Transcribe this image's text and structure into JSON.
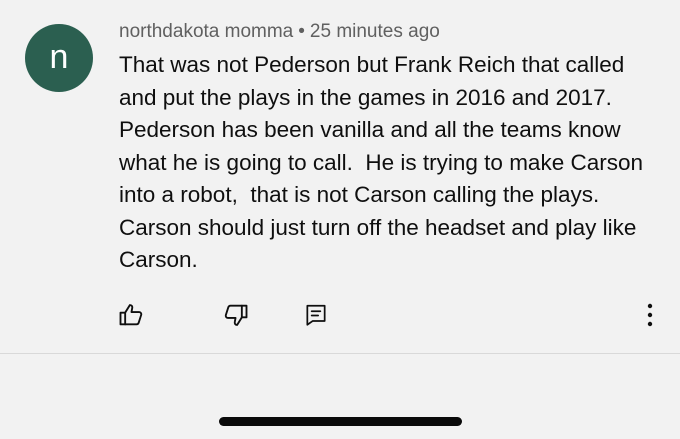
{
  "comment": {
    "avatar_letter": "n",
    "avatar_color": "#2b5f50",
    "author": "northdakota momma",
    "separator": "•",
    "timestamp": "25 minutes ago",
    "lines": [
      "That was not Pederson but Frank Reich that called",
      "and put the plays in the games in 2016 and 2017.",
      "Pederson has been vanilla and all the teams know",
      "what he is going to call.  He is trying to make Carson",
      "into a robot,  that is not Carson calling the plays.",
      "Carson should just turn off the headset and play like",
      "Carson."
    ]
  },
  "actions": {
    "like_icon": "thumbs-up-icon",
    "dislike_icon": "thumbs-down-icon",
    "reply_icon": "comment-reply-icon",
    "more_icon": "more-vertical-icon"
  }
}
